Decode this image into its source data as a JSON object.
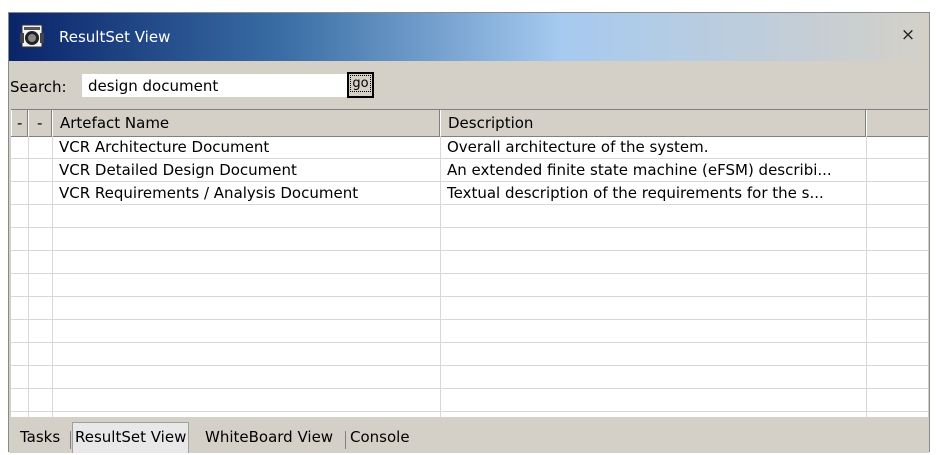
{
  "window": {
    "title": "ResultSet View",
    "close_glyph": "×",
    "icon": "resultset-app-icon"
  },
  "search": {
    "label": "Search:",
    "value": "design document",
    "go_label": "go"
  },
  "table": {
    "columns": [
      "-",
      "-",
      "Artefact Name",
      "Description"
    ],
    "rows": [
      {
        "name": "VCR Architecture Document",
        "description": "Overall architecture of the system."
      },
      {
        "name": "VCR Detailed Design Document",
        "description": "An extended finite state machine (eFSM) describi..."
      },
      {
        "name": "VCR Requirements / Analysis Document",
        "description": "Textual description of the requirements for the s..."
      }
    ]
  },
  "tabs": [
    "Tasks",
    "ResultSet View",
    "WhiteBoard View",
    "Console"
  ],
  "active_tab": "ResultSet View",
  "colors": {
    "title_gradient_start": "#0a246a",
    "title_gradient_end": "#d4d0c8",
    "chrome": "#d4d0c8"
  }
}
